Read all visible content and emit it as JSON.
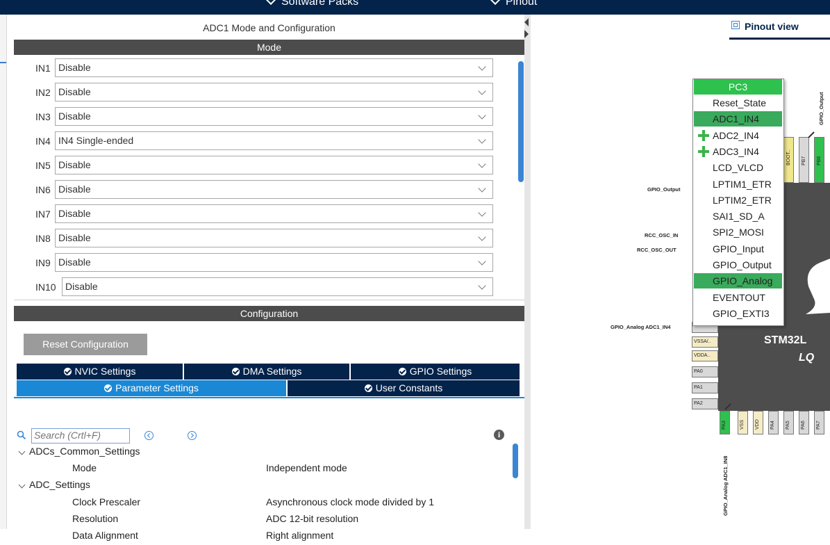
{
  "topnav": {
    "software_packs": "Software Packs",
    "pinout": "Pinout"
  },
  "panel": {
    "title": "ADC1 Mode and Configuration",
    "mode_header": "Mode",
    "config_header": "Configuration"
  },
  "mode_inputs": [
    {
      "label": "IN1",
      "value": "Disable"
    },
    {
      "label": "IN2",
      "value": "Disable"
    },
    {
      "label": "IN3",
      "value": "Disable"
    },
    {
      "label": "IN4",
      "value": "IN4 Single-ended"
    },
    {
      "label": "IN5",
      "value": "Disable"
    },
    {
      "label": "IN6",
      "value": "Disable"
    },
    {
      "label": "IN7",
      "value": "Disable"
    },
    {
      "label": "IN8",
      "value": "Disable"
    },
    {
      "label": "IN9",
      "value": "Disable"
    },
    {
      "label": "IN10",
      "value": "Disable"
    }
  ],
  "config": {
    "reset_button": "Reset Configuration",
    "tabs_row1": [
      "NVIC Settings",
      "DMA Settings",
      "GPIO Settings"
    ],
    "tabs_row2": [
      "Parameter Settings",
      "User Constants"
    ],
    "search_placeholder": "Search (Crtl+F)",
    "tree": [
      {
        "group": "ADCs_Common_Settings",
        "rows": [
          {
            "name": "Mode",
            "value": "Independent mode"
          }
        ]
      },
      {
        "group": "ADC_Settings",
        "rows": [
          {
            "name": "Clock Prescaler",
            "value": "Asynchronous clock mode divided by 1"
          },
          {
            "name": "Resolution",
            "value": "ADC 12-bit resolution"
          },
          {
            "name": "Data Alignment",
            "value": "Right alignment"
          }
        ]
      }
    ]
  },
  "pinout": {
    "view_label": "Pinout view",
    "chip_name": "STM32L",
    "chip_sub": "LQ",
    "popup_header": "PC3",
    "popup_items": [
      "Reset_State",
      "ADC1_IN4",
      "ADC2_IN4",
      "ADC3_IN4",
      "LCD_VLCD",
      "LPTIM1_ETR",
      "LPTIM2_ETR",
      "SAI1_SD_A",
      "SPI2_MOSI",
      "GPIO_Input",
      "GPIO_Output",
      "GPIO_Analog",
      "EVENTOUT",
      "GPIO_EXTI3"
    ],
    "left_signals": [
      "GPIO_Output",
      "RCC_OSC_IN",
      "RCC_OSC_OUT",
      "GPIO_Analog ADC1_IN4"
    ],
    "top_signal": "GPIO_Output",
    "bottom_signal": "GPIO_Analog ADC1_IN8",
    "right_pins": [
      "VSSA/..",
      "VDDA..",
      "PA0",
      "PA1",
      "PA2"
    ],
    "bottom_pins": [
      "PA3",
      "VSS",
      "VDD",
      "PA4",
      "PA5",
      "PA6",
      "PA7"
    ],
    "top_pins": [
      "BOOT..",
      "PB7",
      "PB6"
    ]
  }
}
